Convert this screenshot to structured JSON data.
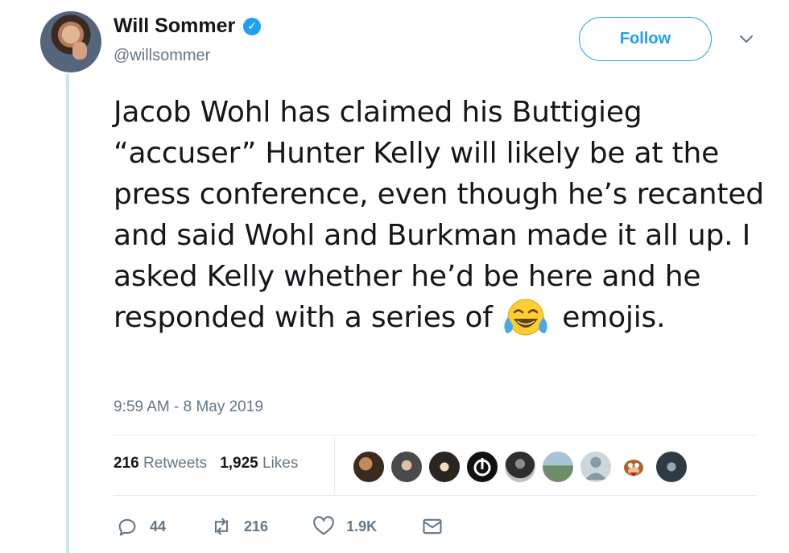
{
  "author": {
    "name": "Will Sommer",
    "handle": "@willsommer",
    "verified_icon": "verified-badge-icon"
  },
  "follow_button": {
    "label": "Follow"
  },
  "tweet": {
    "text_before_emoji": "Jacob Wohl has claimed his Buttigieg “accuser” Hunter Kelly will likely be at the press conference, even though he’s recanted and said Wohl and Burkman made it all up. I asked Kelly whether he’d be here and he responded with a series of",
    "emoji": "face-with-tears-of-joy-emoji",
    "text_after_emoji": "emojis.",
    "timestamp": "9:59 AM - 8 May 2019"
  },
  "stats": {
    "retweets_count": "216",
    "retweets_label": "Retweets",
    "likes_count": "1,925",
    "likes_label": "Likes"
  },
  "actions": {
    "reply_count": "44",
    "retweet_count": "216",
    "like_count": "1.9K"
  },
  "colors": {
    "accent": "#1da1f2",
    "secondary_text": "#657786",
    "thread_line": "#c4e6f7"
  }
}
